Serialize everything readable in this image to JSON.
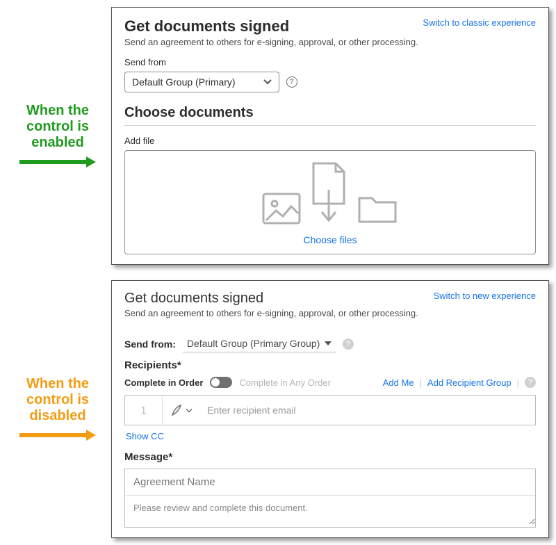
{
  "annotations": {
    "enabled": "When the control is enabled",
    "disabled": "When the control is disabled"
  },
  "panel_modern": {
    "title": "Get documents signed",
    "switch_link": "Switch to classic experience",
    "subtitle": "Send an agreement to others for e-signing, approval, or other processing.",
    "send_from_label": "Send from",
    "send_from_value": "Default Group (Primary)",
    "choose_documents": "Choose documents",
    "add_file_label": "Add file",
    "choose_files": "Choose files"
  },
  "panel_classic": {
    "title": "Get documents signed",
    "switch_link": "Switch to new experience",
    "subtitle": "Send an agreement to others for e-signing, approval, or other processing.",
    "send_from_label": "Send from:",
    "send_from_value": "Default Group (Primary Group)",
    "recipients_label": "Recipients*",
    "complete_in_order": "Complete in Order",
    "complete_any_order": "Complete in Any Order",
    "add_me": "Add Me",
    "add_recipient_group": "Add Recipient Group",
    "recipient_number": "1",
    "recipient_placeholder": "Enter recipient email",
    "show_cc": "Show CC",
    "message_label": "Message*",
    "agreement_name_placeholder": "Agreement Name",
    "message_body": "Please review and complete this document."
  }
}
